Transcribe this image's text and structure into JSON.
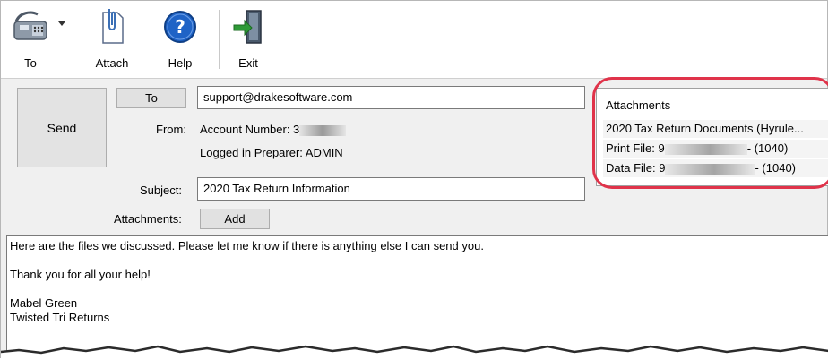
{
  "toolbar": {
    "to_label": "To",
    "attach_label": "Attach",
    "help_label": "Help",
    "exit_label": "Exit"
  },
  "header": {
    "send_label": "Send",
    "to_button_label": "To",
    "to_value": "support@drakesoftware.com",
    "from_label": "From:",
    "account_number": "Account Number: 3",
    "logged_in": "Logged in Preparer: ADMIN",
    "subject_label": "Subject:",
    "subject_value": "2020 Tax Return Information",
    "attachments_label": "Attachments:",
    "add_label": "Add"
  },
  "attachments_panel": {
    "title": "Attachments",
    "items": [
      {
        "name": "2020 Tax Return Documents (Hyrule..."
      },
      {
        "name": "Print File: 9",
        "suffix": "- (1040)"
      },
      {
        "name": "Data File: 9",
        "suffix": "- (1040)"
      }
    ]
  },
  "message": {
    "line1": "Here are the files we discussed. Please let me know if there is anything else I can send you.",
    "line2": "Thank you for all your help!",
    "line3": "Mabel Green",
    "line4": "Twisted Tri Returns"
  },
  "colors": {
    "highlight": "#e0334a",
    "help_icon": "#1f63c6",
    "exit_arrow": "#2e9a37"
  }
}
